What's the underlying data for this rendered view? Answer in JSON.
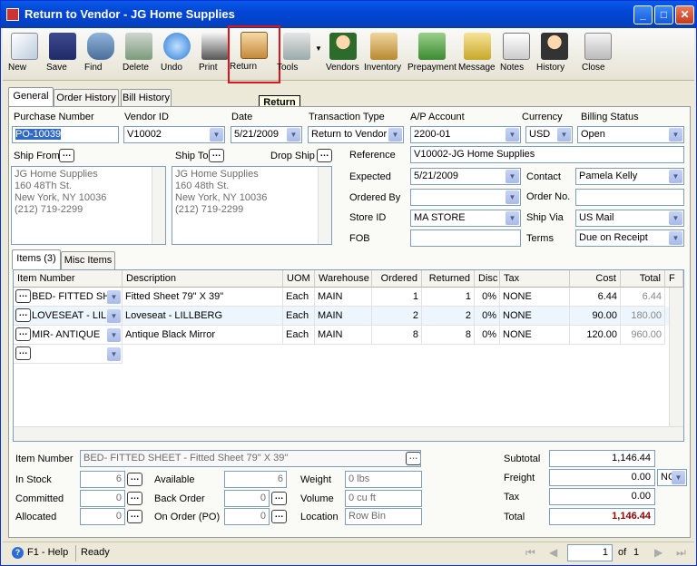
{
  "window": {
    "title": "Return to Vendor - JG Home Supplies"
  },
  "toolbar": {
    "new": "New",
    "save": "Save",
    "find": "Find",
    "delete": "Delete",
    "undo": "Undo",
    "print": "Print",
    "return": "Return",
    "tools": "Tools",
    "vendors": "Vendors",
    "inventory": "Inventory",
    "prepayment": "Prepayment",
    "message": "Message",
    "notes": "Notes",
    "history": "History",
    "close": "Close"
  },
  "tooltip": "Return",
  "tabs": {
    "general": "General",
    "order_history": "Order History",
    "bill_history": "Bill History"
  },
  "header": {
    "purchase_number_label": "Purchase Number",
    "purchase_number": "PO-10039",
    "vendor_id_label": "Vendor ID",
    "vendor_id": "V10002",
    "date_label": "Date",
    "date": "5/21/2009",
    "transaction_type_label": "Transaction Type",
    "transaction_type": "Return to Vendor",
    "ap_account_label": "A/P Account",
    "ap_account": "2200-01",
    "currency_label": "Currency",
    "currency": "USD",
    "billing_status_label": "Billing Status",
    "billing_status": "Open"
  },
  "ship": {
    "ship_from_label": "Ship From",
    "ship_to_label": "Ship To",
    "drop_ship_label": "Drop Ship",
    "ship_from_address": "JG Home Supplies\n160 48Th St.\nNew York, NY 10036\n(212) 719-2299",
    "ship_to_address": "JG Home Supplies\n160 48th St.\nNew York, NY 10036\n(212) 719-2299"
  },
  "details": {
    "reference_label": "Reference",
    "reference": "V10002-JG Home Supplies",
    "expected_label": "Expected",
    "expected": "5/21/2009",
    "contact_label": "Contact",
    "contact": "Pamela Kelly",
    "ordered_by_label": "Ordered By",
    "ordered_by": "",
    "order_no_label": "Order No.",
    "order_no": "",
    "store_id_label": "Store ID",
    "store_id": "MA STORE",
    "ship_via_label": "Ship Via",
    "ship_via": "US Mail",
    "fob_label": "FOB",
    "fob": "",
    "terms_label": "Terms",
    "terms": "Due on Receipt"
  },
  "subtabs": {
    "items": "Items (3)",
    "misc": "Misc Items"
  },
  "grid": {
    "columns": [
      "Item Number",
      "Description",
      "UOM",
      "Warehouse",
      "Ordered",
      "Returned",
      "Disc",
      "Tax",
      "Cost",
      "Total",
      "F"
    ],
    "rows": [
      [
        "BED- FITTED SHE",
        "Fitted Sheet 79\" X 39\"",
        "Each",
        "MAIN",
        "1",
        "1",
        "0%",
        "NONE",
        "6.44",
        "6.44"
      ],
      [
        "LOVESEAT - LILLE",
        "Loveseat - LILLBERG",
        "Each",
        "MAIN",
        "2",
        "2",
        "0%",
        "NONE",
        "90.00",
        "180.00"
      ],
      [
        "MIR- ANTIQUE",
        "Antique Black Mirror",
        "Each",
        "MAIN",
        "8",
        "8",
        "0%",
        "NONE",
        "120.00",
        "960.00"
      ]
    ]
  },
  "item_info": {
    "item_number_label": "Item Number",
    "item_number": "BED- FITTED SHEET - Fitted Sheet 79\" X 39\"",
    "in_stock_label": "In Stock",
    "in_stock": "6",
    "committed_label": "Committed",
    "committed": "0",
    "allocated_label": "Allocated",
    "allocated": "0",
    "available_label": "Available",
    "available": "6",
    "back_order_label": "Back Order",
    "back_order": "0",
    "on_order_label": "On Order (PO)",
    "on_order": "0",
    "weight_label": "Weight",
    "weight": "0 lbs",
    "volume_label": "Volume",
    "volume": "0 cu ft",
    "location_label": "Location",
    "location": "Row  Bin"
  },
  "totals": {
    "subtotal_label": "Subtotal",
    "subtotal": "1,146.44",
    "freight_label": "Freight",
    "freight": "0.00",
    "freight_code": "NC",
    "tax_label": "Tax",
    "tax": "0.00",
    "total_label": "Total",
    "total": "1,146.44"
  },
  "statusbar": {
    "help": "F1 - Help",
    "status": "Ready",
    "page": "1",
    "of_label": "of",
    "total_pages": "1"
  },
  "colors": {
    "title_blue": "#0346d6",
    "accent_red": "#e0131d",
    "total_red": "#8b0000"
  }
}
